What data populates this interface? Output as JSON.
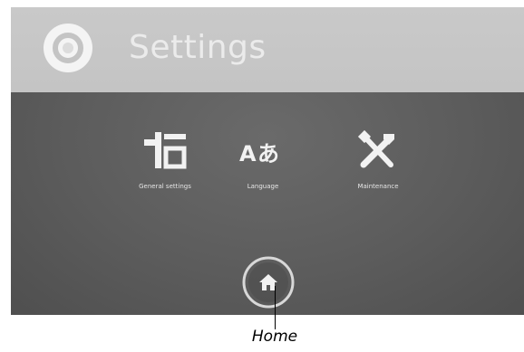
{
  "header": {
    "title": "Settings",
    "icon": "gear-icon"
  },
  "tiles": [
    {
      "label": "General settings",
      "icon": "sliders-icon"
    },
    {
      "label": "Language",
      "icon": "language-icon"
    },
    {
      "label": "Maintenance",
      "icon": "tools-icon"
    }
  ],
  "home": {
    "icon": "home-icon"
  },
  "callout": {
    "label": "Home"
  },
  "colors": {
    "header_bg": "#c6c6c6",
    "panel_bg": "#5a5a5a",
    "icon": "#f2f2f2"
  }
}
